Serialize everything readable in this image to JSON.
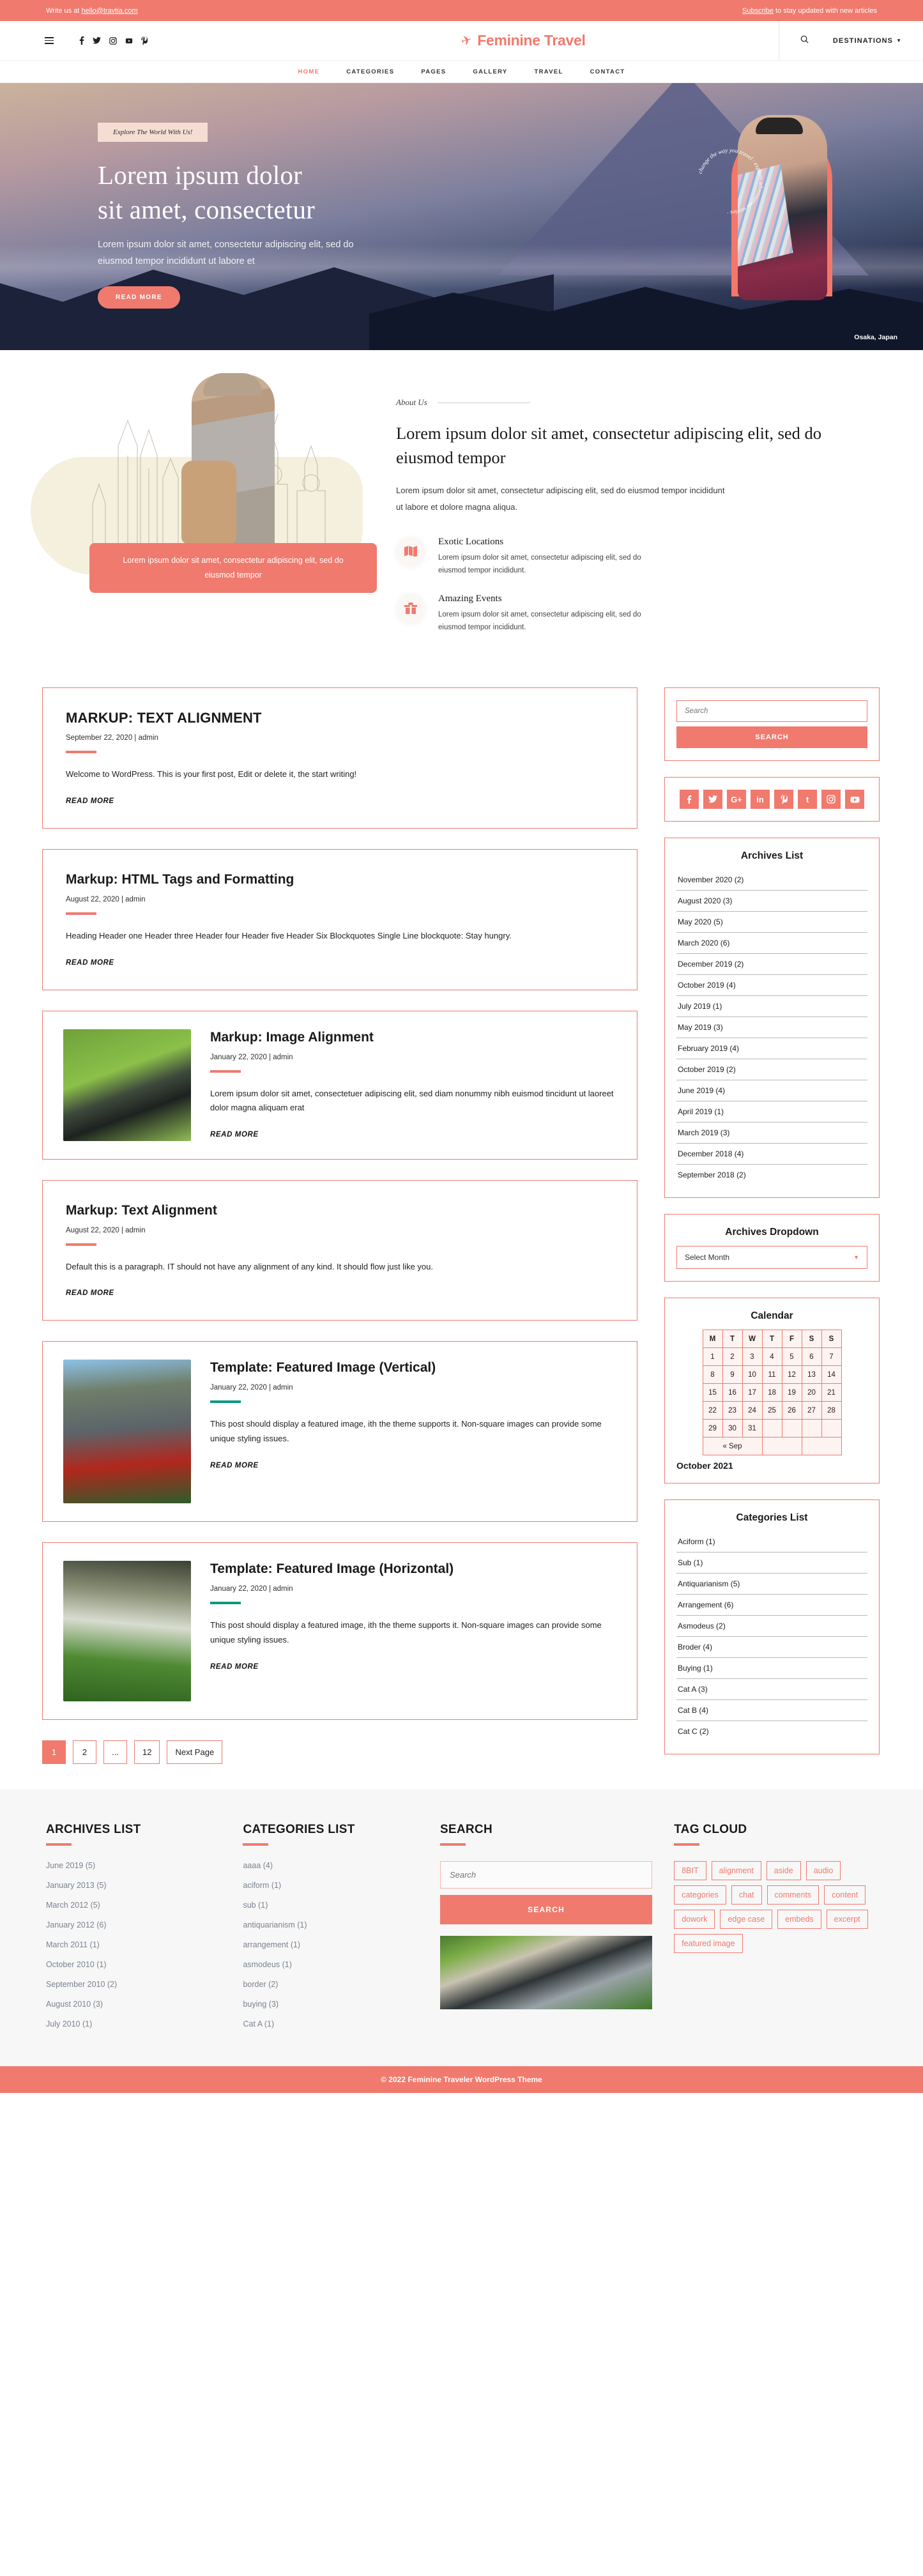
{
  "topbar": {
    "left_prefix": "Write us at ",
    "left_email": "hello@travtia.com",
    "right_link": "Subscribe",
    "right_rest": " to stay updated with new articles"
  },
  "header": {
    "menu_icon": "hamburger-icon",
    "social": [
      "facebook-icon",
      "twitter-icon",
      "instagram-icon",
      "youtube-icon",
      "pinterest-icon"
    ],
    "logo_text": "Feminine Travel",
    "logo_icon": "airplane-icon",
    "search_icon": "search-icon",
    "destinations_label": "DESTINATIONS",
    "destinations_caret": "chevron-down-icon"
  },
  "mainnav": {
    "items": [
      {
        "label": "HOME",
        "active": true
      },
      {
        "label": "CATEGORIES",
        "active": false
      },
      {
        "label": "PAGES",
        "active": false
      },
      {
        "label": "GALLERY",
        "active": false
      },
      {
        "label": "TRAVEL",
        "active": false
      },
      {
        "label": "CONTACT",
        "active": false
      }
    ]
  },
  "hero": {
    "badge": "Explore The World With Us!",
    "title_line1": "Lorem ipsum dolor",
    "title_line2": "sit amet, consectetur",
    "subtitle": "Lorem ipsum dolor sit amet, consectetur adipiscing elit, sed do eiusmod tempor incididunt ut labore et",
    "button": "READ MORE",
    "circle_text": "change the way you travel · explore adventurous stories ·",
    "caption": "Osaka, Japan"
  },
  "about": {
    "kicker": "About Us",
    "title": "Lorem ipsum dolor sit amet, consectetur adipiscing elit, sed do eiusmod tempor",
    "text": "Lorem ipsum dolor sit amet, consectetur adipiscing elit, sed do eiusmod tempor incididunt ut labore et dolore magna aliqua.",
    "callout": "Lorem ipsum dolor sit amet, consectetur adipiscing elit, sed do eiusmod tempor",
    "features": [
      {
        "icon": "map-icon",
        "heading": "Exotic Locations",
        "text": "Lorem ipsum dolor sit amet, consectetur adipiscing elit, sed do eiusmod tempor incididunt."
      },
      {
        "icon": "gift-icon",
        "heading": "Amazing Events",
        "text": "Lorem ipsum dolor sit amet, consectetur adipiscing elit, sed do eiusmod tempor incididunt."
      }
    ]
  },
  "posts": [
    {
      "title": "MARKUP: TEXT ALIGNMENT",
      "meta": "September 22, 2020 | admin",
      "body": "Welcome to WordPress. This is your first post, Edit or delete it, the start writing!",
      "readmore": "READ MORE",
      "divider": "coral",
      "image": null
    },
    {
      "title": "Markup: HTML Tags and Formatting",
      "meta": "August 22, 2020 | admin",
      "body": "Heading Header one Header three Header four Header five Header Six Blockquotes Single Line blockquote: Stay hungry.",
      "readmore": "READ MORE",
      "divider": "coral",
      "image": null
    },
    {
      "title": "Markup: Image Alignment",
      "meta": "January 22, 2020 | admin",
      "body": "Lorem ipsum dolor sit amet, consectetuer adipiscing elit, sed diam nonummy nibh euismod tincidunt ut laoreet dolor magna aliquam erat",
      "readmore": "READ MORE",
      "divider": "coral",
      "image": "laptop-in-grass-thumbnail"
    },
    {
      "title": "Markup: Text Alignment",
      "meta": "August 22, 2020 | admin",
      "body": "Default this is a paragraph. IT should not have any alignment of any kind. It should flow just like you.",
      "readmore": "READ MORE",
      "divider": "coral",
      "image": null
    },
    {
      "title": "Template: Featured Image (Vertical)",
      "meta": "January 22, 2020 | admin",
      "body": "This post should display a featured image, ith the theme supports it. Non-square images can provide some unique styling issues.",
      "readmore": "READ MORE",
      "divider": "teal",
      "image": "stone-house-with-flowers-thumbnail"
    },
    {
      "title": "Template: Featured Image (Horizontal)",
      "meta": "January 22, 2020 | admin",
      "body": "This post should display a featured image, ith the theme supports it. Non-square images can provide some unique styling issues.",
      "readmore": "READ MORE",
      "divider": "teal",
      "image": "garden-swing-thumbnail"
    }
  ],
  "pagination": {
    "pages": [
      "1",
      "2",
      "...",
      "12",
      "Next Page"
    ],
    "active_index": 0
  },
  "sidebar": {
    "search": {
      "placeholder": "Search",
      "button": "SEARCH"
    },
    "social_icons": [
      "facebook-icon",
      "twitter-icon",
      "google-plus-icon",
      "linkedin-icon",
      "pinterest-icon",
      "tumblr-icon",
      "instagram-icon",
      "youtube-icon"
    ],
    "archives": {
      "title": "Archives List",
      "items": [
        "November 2020 (2)",
        "August 2020 (3)",
        "May 2020 (5)",
        "March 2020 (6)",
        "December 2019 (2)",
        "October 2019 (4)",
        "July 2019 (1)",
        "May 2019 (3)",
        "February 2019 (4)",
        "October 2019 (2)",
        "June 2019 (4)",
        "April 2019 (1)",
        "March 2019 (3)",
        "December 2018 (4)",
        "September 2018 (2)"
      ]
    },
    "archives_dropdown": {
      "title": "Archives Dropdown",
      "selected": "Select Month"
    },
    "calendar": {
      "title": "Calendar",
      "weekdays": [
        "M",
        "T",
        "W",
        "T",
        "F",
        "S",
        "S"
      ],
      "weeks": [
        [
          "1",
          "2",
          "3",
          "4",
          "5",
          "6",
          "7"
        ],
        [
          "8",
          "9",
          "10",
          "11",
          "12",
          "13",
          "14"
        ],
        [
          "15",
          "16",
          "17",
          "18",
          "19",
          "20",
          "21"
        ],
        [
          "22",
          "23",
          "24",
          "25",
          "26",
          "27",
          "28"
        ],
        [
          "29",
          "30",
          "31",
          "",
          "",
          "",
          ""
        ]
      ],
      "prev": "« Sep",
      "month_label": "October 2021"
    },
    "categories": {
      "title": "Categories List",
      "items": [
        "Aciform (1)",
        "Sub (1)",
        "Antiquarianism (5)",
        "Arrangement (6)",
        "Asmodeus (2)",
        "Broder (4)",
        "Buying (1)",
        "Cat A (3)",
        "Cat B (4)",
        "Cat C (2)"
      ]
    }
  },
  "footer": {
    "archives": {
      "title": "ARCHIVES LIST",
      "items": [
        "June 2019 (5)",
        "January  2013 (5)",
        "March 2012 (5)",
        "January  2012 (6)",
        "March  2011 (1)",
        "October 2010 (1)",
        "September 2010 (2)",
        "August 2010 (3)",
        "July 2010 (1)"
      ]
    },
    "categories": {
      "title": "CATEGORIES LIST",
      "items": [
        "aaaa (4)",
        "aciform (1)",
        "sub (1)",
        "antiquarianism (1)",
        "arrangement (1)",
        "asmodeus (1)",
        "border (2)",
        "buying (3)",
        "Cat A (1)"
      ]
    },
    "search": {
      "title": "SEARCH",
      "placeholder": "Search",
      "button": "SEARCH",
      "image": "lawn-mower-thumbnail"
    },
    "tagcloud": {
      "title": "TAG CLOUD",
      "tags": [
        "8BIT",
        "alignment",
        "aside",
        "audio",
        "categories",
        "chat",
        "comments",
        "content",
        "dowork",
        "edge case",
        "embeds",
        "excerpt",
        "featured image"
      ]
    },
    "copyright": "© 2022 Feminine Traveler WordPress Theme"
  },
  "colors": {
    "accent": "#f07a6e",
    "teal": "#089981",
    "footer_bg": "#f7f7f7",
    "muted_text": "#7b8290"
  }
}
